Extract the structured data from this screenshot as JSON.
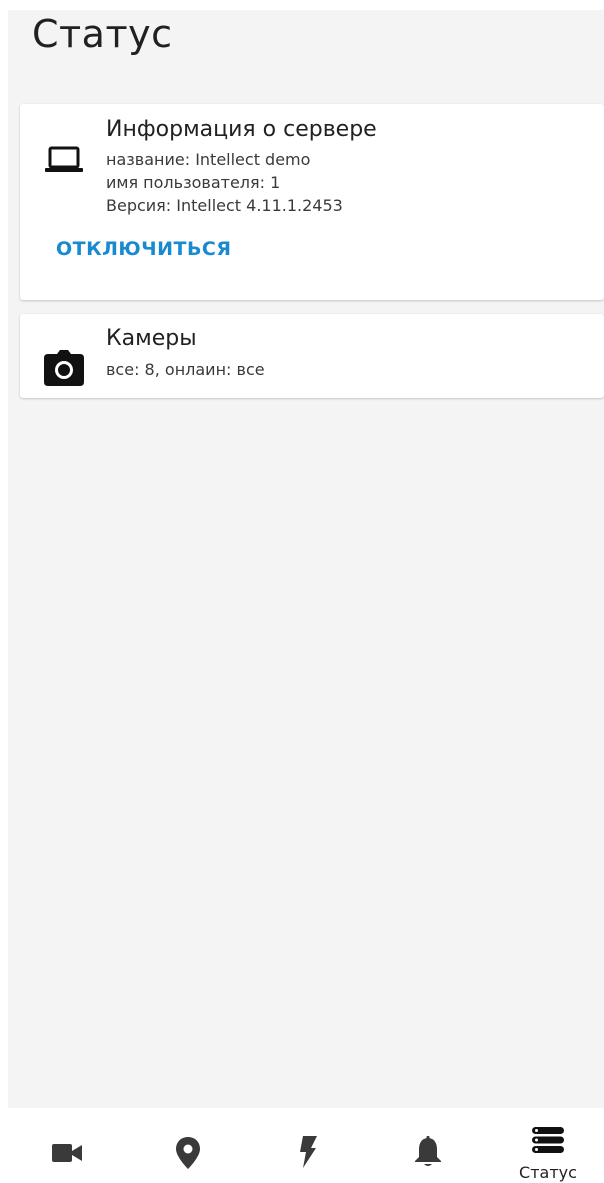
{
  "page": {
    "title": "Статус"
  },
  "server_card": {
    "title": "Информация о сервере",
    "lines": [
      "название: Intellect demo",
      "имя пользователя: 1",
      "Версия: Intellect 4.11.1.2453"
    ],
    "action_label": "ОТКЛЮЧИТЬСЯ",
    "icon": "laptop-icon"
  },
  "cameras_card": {
    "title": "Камеры",
    "summary": "все: 8, онлаин: все",
    "icon": "camera-icon"
  },
  "bottom_nav": {
    "items": [
      {
        "icon": "video-camera-icon",
        "label": ""
      },
      {
        "icon": "map-pin-icon",
        "label": ""
      },
      {
        "icon": "lightning-icon",
        "label": ""
      },
      {
        "icon": "bell-icon",
        "label": ""
      },
      {
        "icon": "server-stack-icon",
        "label": "Статус",
        "active": true
      }
    ]
  },
  "colors": {
    "background": "#f4f4f4",
    "card": "#ffffff",
    "accent": "#1a8ad0",
    "text": "#212121",
    "icon": "#3a3a3a"
  }
}
